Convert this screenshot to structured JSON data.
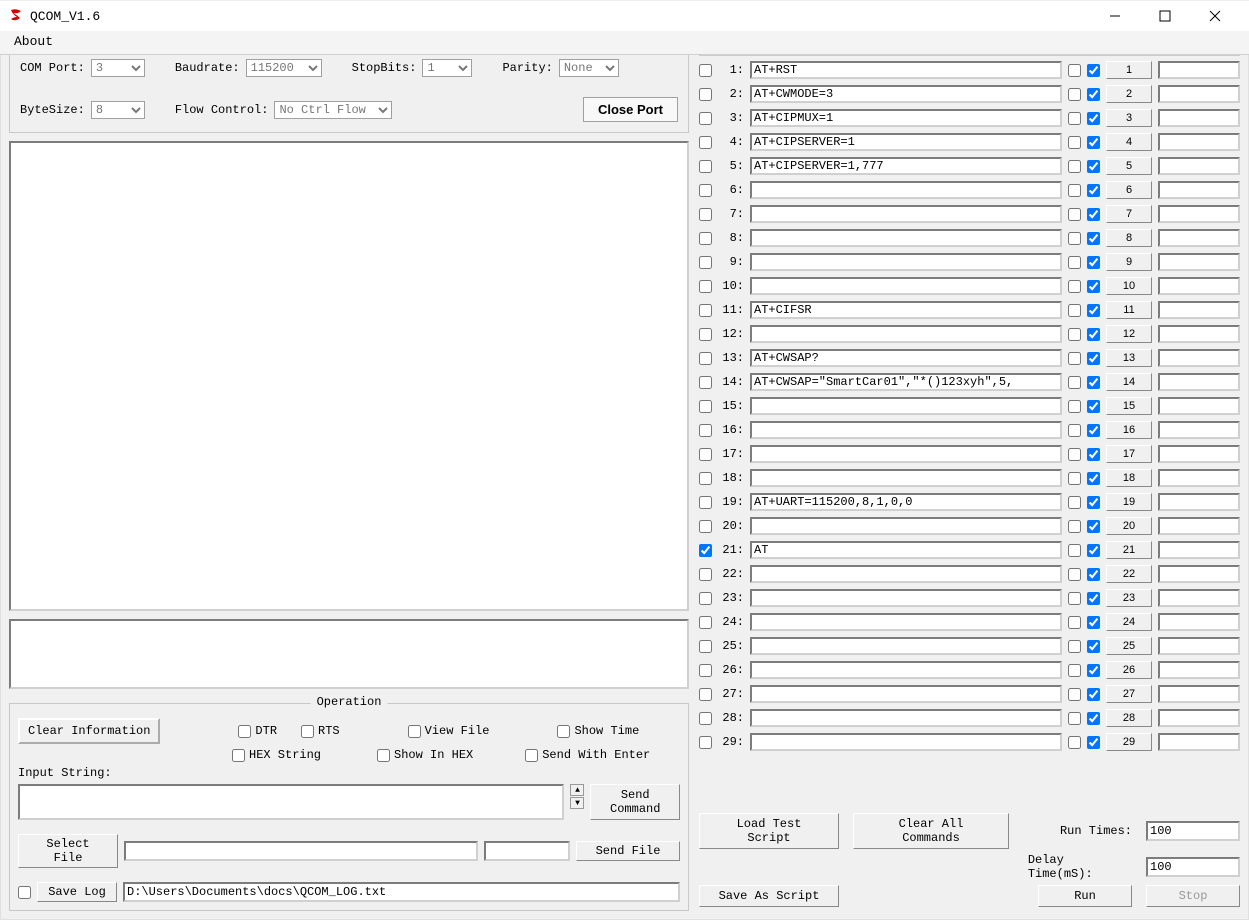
{
  "window": {
    "title": "QCOM_V1.6"
  },
  "menu": {
    "about": "About"
  },
  "port": {
    "com_label": "COM Port:",
    "com_value": "3",
    "baud_label": "Baudrate:",
    "baud_value": "115200",
    "stop_label": "StopBits:",
    "stop_value": "1",
    "parity_label": "Parity:",
    "parity_value": "None",
    "bytesize_label": "ByteSize:",
    "bytesize_value": "8",
    "flow_label": "Flow Control:",
    "flow_value": "No Ctrl Flow",
    "close_btn": "Close Port"
  },
  "operation": {
    "legend": "Operation",
    "clear_info": "Clear Information",
    "dtr": "DTR",
    "rts": "RTS",
    "view_file": "View File",
    "show_time": "Show Time",
    "hex_string": "HEX String",
    "show_in_hex": "Show In HEX",
    "send_with_enter": "Send With Enter",
    "input_string": "Input String:",
    "send_command": "Send Command",
    "select_file": "Select File",
    "send_file": "Send File",
    "save_log": "Save Log",
    "log_path": "D:\\Users\\Documents\\docs\\QCOM_LOG.txt"
  },
  "right": {
    "load_script": "Load Test Script",
    "clear_all": "Clear All Commands",
    "save_script": "Save As Script",
    "run_times_lbl": "Run Times:",
    "run_times_val": "100",
    "delay_lbl": "Delay Time(mS):",
    "delay_val": "100",
    "run": "Run",
    "stop": "Stop"
  },
  "commands": [
    {
      "n": 1,
      "sel": false,
      "text": "AT+RST",
      "c1": false,
      "c2": true,
      "delay": ""
    },
    {
      "n": 2,
      "sel": false,
      "text": "AT+CWMODE=3",
      "c1": false,
      "c2": true,
      "delay": ""
    },
    {
      "n": 3,
      "sel": false,
      "text": "AT+CIPMUX=1",
      "c1": false,
      "c2": true,
      "delay": ""
    },
    {
      "n": 4,
      "sel": false,
      "text": "AT+CIPSERVER=1",
      "c1": false,
      "c2": true,
      "delay": ""
    },
    {
      "n": 5,
      "sel": false,
      "text": "AT+CIPSERVER=1,777",
      "c1": false,
      "c2": true,
      "delay": ""
    },
    {
      "n": 6,
      "sel": false,
      "text": "",
      "c1": false,
      "c2": true,
      "delay": ""
    },
    {
      "n": 7,
      "sel": false,
      "text": "",
      "c1": false,
      "c2": true,
      "delay": ""
    },
    {
      "n": 8,
      "sel": false,
      "text": "",
      "c1": false,
      "c2": true,
      "delay": ""
    },
    {
      "n": 9,
      "sel": false,
      "text": "",
      "c1": false,
      "c2": true,
      "delay": ""
    },
    {
      "n": 10,
      "sel": false,
      "text": "",
      "c1": false,
      "c2": true,
      "delay": ""
    },
    {
      "n": 11,
      "sel": false,
      "text": "AT+CIFSR",
      "c1": false,
      "c2": true,
      "delay": ""
    },
    {
      "n": 12,
      "sel": false,
      "text": "",
      "c1": false,
      "c2": true,
      "delay": ""
    },
    {
      "n": 13,
      "sel": false,
      "text": "AT+CWSAP?",
      "c1": false,
      "c2": true,
      "delay": ""
    },
    {
      "n": 14,
      "sel": false,
      "text": "AT+CWSAP=\"SmartCar01\",\"*()123xyh\",5,",
      "c1": false,
      "c2": true,
      "delay": ""
    },
    {
      "n": 15,
      "sel": false,
      "text": "",
      "c1": false,
      "c2": true,
      "delay": ""
    },
    {
      "n": 16,
      "sel": false,
      "text": "",
      "c1": false,
      "c2": true,
      "delay": ""
    },
    {
      "n": 17,
      "sel": false,
      "text": "",
      "c1": false,
      "c2": true,
      "delay": ""
    },
    {
      "n": 18,
      "sel": false,
      "text": "",
      "c1": false,
      "c2": true,
      "delay": ""
    },
    {
      "n": 19,
      "sel": false,
      "text": "AT+UART=115200,8,1,0,0",
      "c1": false,
      "c2": true,
      "delay": ""
    },
    {
      "n": 20,
      "sel": false,
      "text": "",
      "c1": false,
      "c2": true,
      "delay": ""
    },
    {
      "n": 21,
      "sel": true,
      "text": "AT",
      "c1": false,
      "c2": true,
      "delay": ""
    },
    {
      "n": 22,
      "sel": false,
      "text": "",
      "c1": false,
      "c2": true,
      "delay": ""
    },
    {
      "n": 23,
      "sel": false,
      "text": "",
      "c1": false,
      "c2": true,
      "delay": ""
    },
    {
      "n": 24,
      "sel": false,
      "text": "",
      "c1": false,
      "c2": true,
      "delay": ""
    },
    {
      "n": 25,
      "sel": false,
      "text": "",
      "c1": false,
      "c2": true,
      "delay": ""
    },
    {
      "n": 26,
      "sel": false,
      "text": "",
      "c1": false,
      "c2": true,
      "delay": ""
    },
    {
      "n": 27,
      "sel": false,
      "text": "",
      "c1": false,
      "c2": true,
      "delay": ""
    },
    {
      "n": 28,
      "sel": false,
      "text": "",
      "c1": false,
      "c2": true,
      "delay": ""
    },
    {
      "n": 29,
      "sel": false,
      "text": "",
      "c1": false,
      "c2": true,
      "delay": ""
    }
  ]
}
